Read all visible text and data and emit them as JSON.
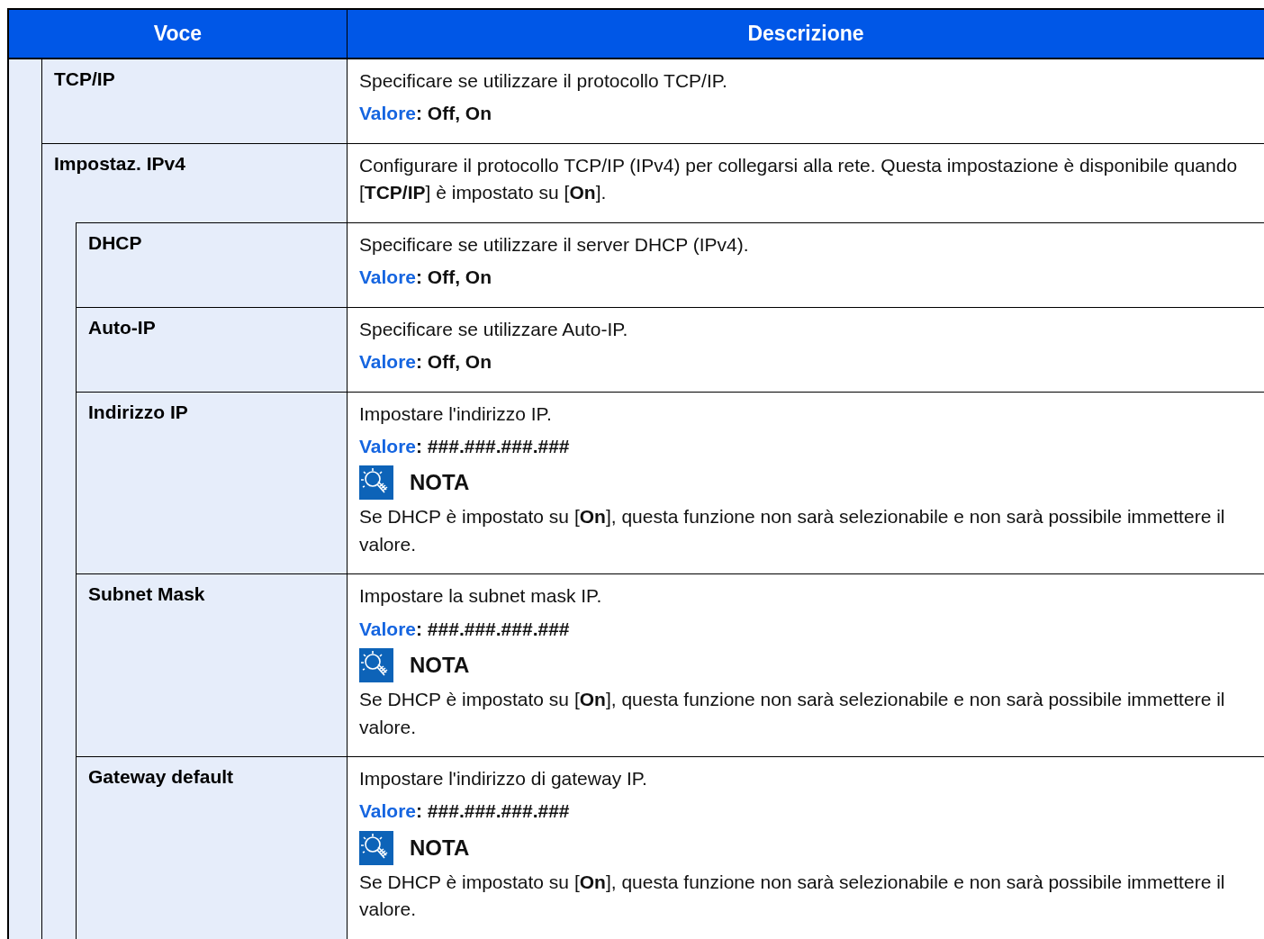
{
  "table": {
    "columns": [
      "Voce",
      "Descrizione"
    ],
    "rows": [
      {
        "item": "TCP/IP",
        "description": "Specificare se utilizzare il protocollo TCP/IP.",
        "value_label": "Valore",
        "value": ": Off, On"
      },
      {
        "item": "Impostaz. IPv4",
        "description": "Configurare il protocollo TCP/IP (IPv4) per collegarsi alla rete. Questa impostazione è disponibile quando [**TCP/IP**] è impostato su [**On**].",
        "children": [
          {
            "item": "DHCP",
            "description": "Specificare se utilizzare il server DHCP (IPv4).",
            "value_label": "Valore",
            "value": ": Off, On"
          },
          {
            "item": "Auto-IP",
            "description": "Specificare se utilizzare Auto-IP.",
            "value_label": "Valore",
            "value": ": Off, On"
          },
          {
            "item": "Indirizzo IP",
            "description": "Impostare l'indirizzo IP.",
            "value_label": "Valore",
            "value": ": ###.###.###.###",
            "note": {
              "title": "NOTA",
              "text": "Se DHCP è impostato su [**On**], questa funzione non sarà selezionabile e non sarà possibile immettere il valore."
            }
          },
          {
            "item": "Subnet Mask",
            "description": "Impostare la subnet mask IP.",
            "value_label": "Valore",
            "value": ": ###.###.###.###",
            "note": {
              "title": "NOTA",
              "text": "Se DHCP è impostato su [**On**], questa funzione non sarà selezionabile e non sarà possibile immettere il valore."
            }
          },
          {
            "item": "Gateway default",
            "description": "Impostare l'indirizzo di gateway IP.",
            "value_label": "Valore",
            "value": ": ###.###.###.###",
            "note": {
              "title": "NOTA",
              "text": "Se DHCP è impostato su [**On**], questa funzione non sarà selezionabile e non sarà possibile immettere il valore."
            }
          }
        ]
      }
    ]
  }
}
